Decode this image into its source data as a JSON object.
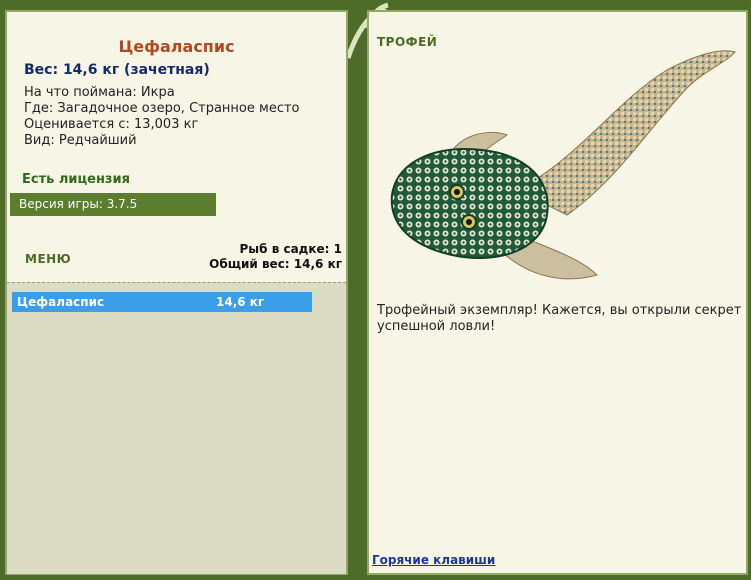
{
  "fish": {
    "name": "Цефаласпис",
    "weight_line": "Вес: 14,6 кг (зачетная)",
    "caught_on": "На что поймана: Икра",
    "where": "Где: Загадочное озеро, Странное место",
    "valued_from": "Оценивается с: 13,003 кг",
    "kind": "Вид: Редчайший"
  },
  "license": "Есть лицензия",
  "version": "Версия игры: 3.7.5",
  "menu_label": "МЕНЮ",
  "keepnet": {
    "count_line": "Рыб в садке: 1",
    "total_line": "Общий вес: 14,6 кг"
  },
  "list": [
    {
      "name": "Цефаласпис",
      "weight": "14,6 кг"
    }
  ],
  "trophy": {
    "label": "ТРОФЕЙ",
    "text": "Трофейный экземпляр! Кажется, вы открыли секрет успешной ловли!"
  },
  "hotkeys_label": "Горячие клавиши",
  "icons": {
    "fish_image": "cephalaspis-fish-image",
    "vine": "vine-decoration-icon"
  },
  "colors": {
    "background": "#4f6b2a",
    "panel": "#f6f5e6",
    "list_bg": "#dcdcc4",
    "selection": "#3a9ee8",
    "title": "#b24a1d",
    "accent_green": "#5a7d2e"
  }
}
